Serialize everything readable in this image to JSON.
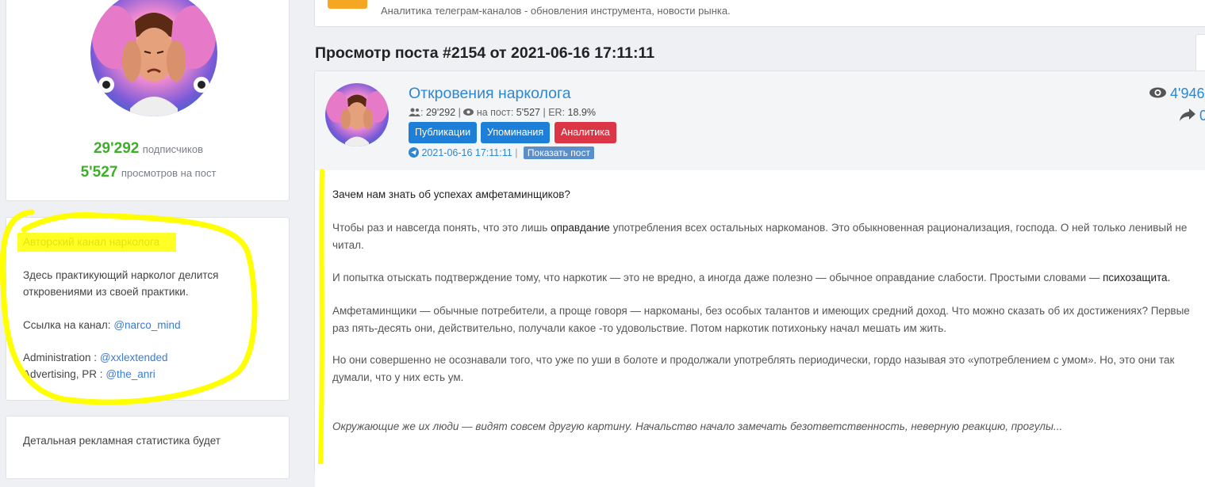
{
  "sidebar": {
    "subscribers_value": "29'292",
    "subscribers_label": "подписчиков",
    "views_value": "5'527",
    "views_label": "просмотров на пост",
    "about": {
      "title": "Авторский канал нарколога",
      "desc_line1": "Здесь практикующий нарколог делится",
      "desc_line2": "откровениями из своей практики.",
      "link_label": "Ссылка на канал:",
      "link_value": "@narco_mind",
      "admin_label": "Administration :",
      "admin_value": "@xxlextended",
      "ads_label": "Advertising, PR :",
      "ads_value": "@the_anri"
    },
    "ads_stats_text": "Детальная рекламная статистика будет"
  },
  "banner": {
    "text": "Аналитика телеграм-каналов - обновления инструмента, новости рынка."
  },
  "page": {
    "heading": "Просмотр поста #2154 от 2021-06-16 17:11:11"
  },
  "post": {
    "channel_name": "Откровения нарколога",
    "subscribers": "29'292",
    "per_post_label": "на пост:",
    "per_post": "5'527",
    "er_label": "ER:",
    "er": "18.9%",
    "buttons": {
      "publications": "Публикации",
      "mentions": "Упоминания",
      "analytics": "Аналитика"
    },
    "date": "2021-06-16 17:11:11",
    "show_post": "Показать пост",
    "views": "4'946",
    "shares": "0",
    "paragraphs": {
      "p1": "Зачем нам знать об успехах амфетаминщиков?",
      "p2a": "Чтобы раз и навсегда понять, что это лишь ",
      "p2b": "оправдание",
      "p2c": " употребления всех остальных наркоманов. Это обыкновенная рационализация, господа. О ней только ленивый не читал.",
      "p3a": "И попытка отыскать подтверждение тому, что наркотик — это не вредно, а иногда даже полезно — обычное оправдание слабости. Простыми словами — ",
      "p3b": "психозащита.",
      "p4": "Амфетаминщики — обычные потребители, а проще говоря — наркоманы, без особых талантов и имеющих средний доход. Что можно сказать об их достижениях? Первые раз пять-десять они, действительно, получали какое -то удовольствие. Потом наркотик потихоньку начал мешать им жить.",
      "p5": "Но они совершенно не осознавали того, что уже по уши в болоте и продолжали употреблять периодически, гордо называя это «употреблением с умом». Но, это они так думали, что у них есть ум.",
      "p6": "Окружающие же их люди — видят совсем другую картину. Начальство начало замечать безответственность, неверную реакцию, прогулы..."
    }
  },
  "colors": {
    "accent": "#2f86d1",
    "green": "#3fae2a",
    "red": "#dc3545",
    "highlight": "#ffff00"
  }
}
